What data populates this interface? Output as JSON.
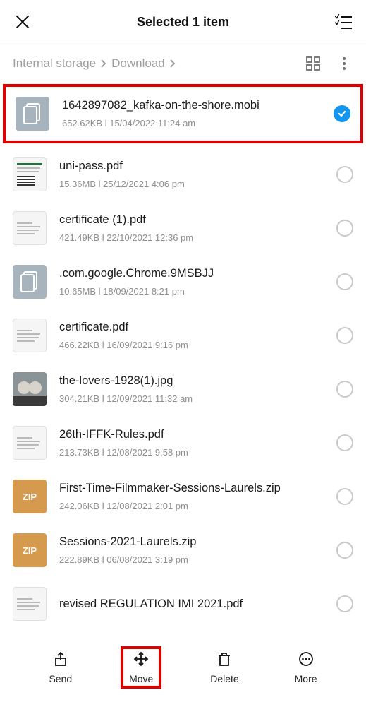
{
  "header": {
    "title": "Selected 1 item"
  },
  "breadcrumb": {
    "root": "Internal storage",
    "current": "Download"
  },
  "files": [
    {
      "name": "1642897082_kafka-on-the-shore.mobi",
      "size": "652.62KB",
      "date": "15/04/2022 11:24 am",
      "thumb": "doc-gray",
      "selected": true,
      "highlight": true
    },
    {
      "name": "uni-pass.pdf",
      "size": "15.36MB",
      "date": "25/12/2021 4:06 pm",
      "thumb": "pdf-qr",
      "selected": false
    },
    {
      "name": "certificate (1).pdf",
      "size": "421.49KB",
      "date": "22/10/2021 12:36 pm",
      "thumb": "pdf",
      "selected": false
    },
    {
      "name": ".com.google.Chrome.9MSBJJ",
      "size": "10.65MB",
      "date": "18/09/2021 8:21 pm",
      "thumb": "doc-gray",
      "selected": false
    },
    {
      "name": "certificate.pdf",
      "size": "466.22KB",
      "date": "16/09/2021 9:16 pm",
      "thumb": "pdf",
      "selected": false
    },
    {
      "name": "the-lovers-1928(1).jpg",
      "size": "304.21KB",
      "date": "12/09/2021 11:32 am",
      "thumb": "img",
      "selected": false
    },
    {
      "name": "26th-IFFK-Rules.pdf",
      "size": "213.73KB",
      "date": "12/08/2021 9:58 pm",
      "thumb": "pdf",
      "selected": false
    },
    {
      "name": "First-Time-Filmmaker-Sessions-Laurels.zip",
      "size": "242.06KB",
      "date": "12/08/2021 2:01 pm",
      "thumb": "zip",
      "selected": false
    },
    {
      "name": "Sessions-2021-Laurels.zip",
      "size": "222.89KB",
      "date": "06/08/2021 3:19 pm",
      "thumb": "zip",
      "selected": false
    },
    {
      "name": "revised REGULATION IMI 2021.pdf",
      "size": "",
      "date": "",
      "thumb": "pdf",
      "selected": false,
      "truncated": true
    }
  ],
  "actions": {
    "send": "Send",
    "move": "Move",
    "delete": "Delete",
    "more": "More"
  },
  "zip_label": "ZIP"
}
